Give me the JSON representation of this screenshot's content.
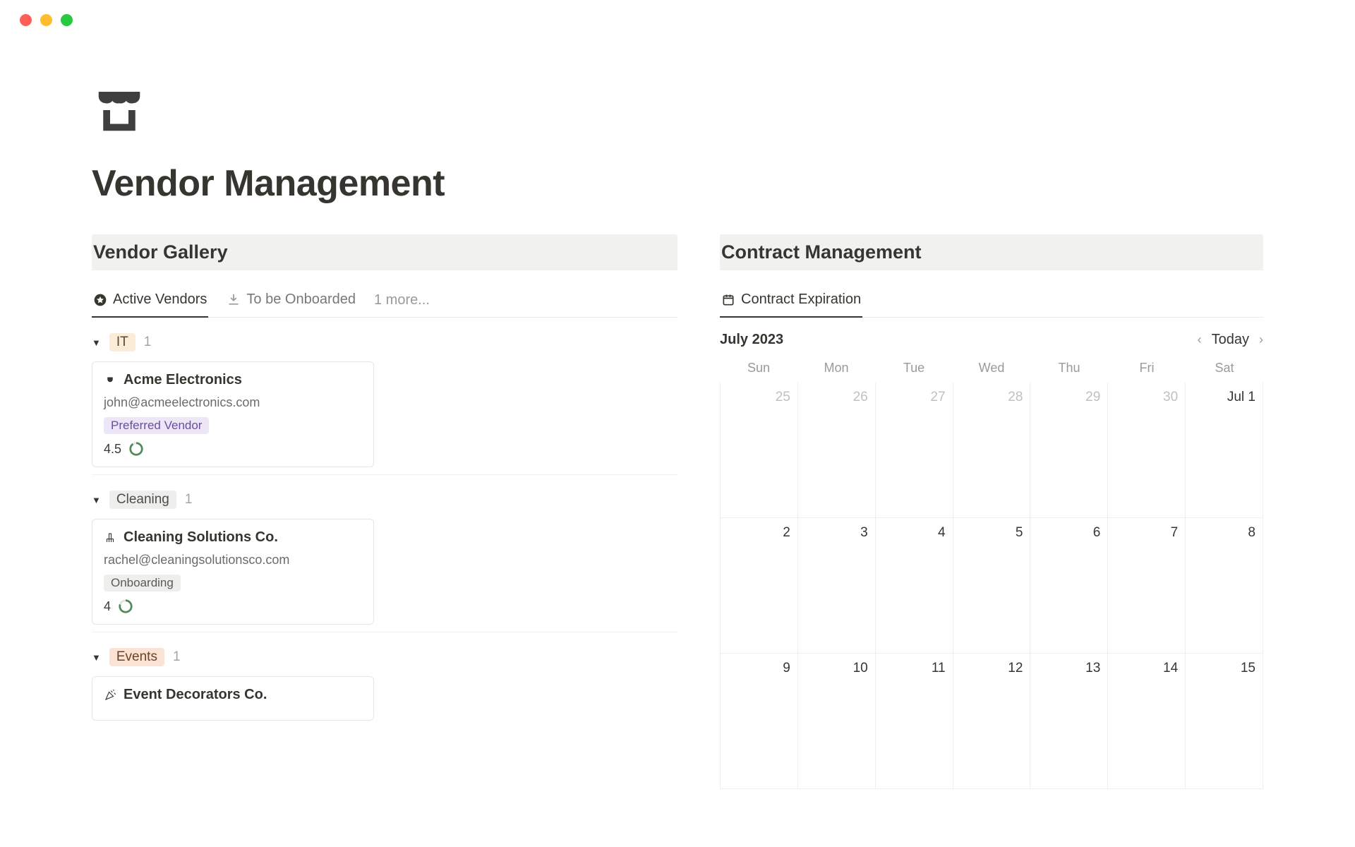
{
  "page": {
    "title": "Vendor Management"
  },
  "sections": {
    "gallery": {
      "title": "Vendor Gallery"
    },
    "contracts": {
      "title": "Contract Management"
    }
  },
  "gallery_tabs": {
    "active": "Active Vendors",
    "onboard": "To be Onboarded",
    "more": "1 more..."
  },
  "groups": {
    "it": {
      "label": "IT",
      "count": "1"
    },
    "cleaning": {
      "label": "Cleaning",
      "count": "1"
    },
    "events": {
      "label": "Events",
      "count": "1"
    }
  },
  "cards": {
    "acme": {
      "title": "Acme Electronics",
      "email": "john@acmeelectronics.com",
      "badge": "Preferred Vendor",
      "rating": "4.5"
    },
    "cleaning": {
      "title": "Cleaning Solutions Co.",
      "email": "rachel@cleaningsolutionsco.com",
      "badge": "Onboarding",
      "rating": "4"
    },
    "events": {
      "title": "Event Decorators Co."
    }
  },
  "contracts_tab": "Contract Expiration",
  "calendar": {
    "month": "July 2023",
    "today": "Today",
    "dow": {
      "sun": "Sun",
      "mon": "Mon",
      "tue": "Tue",
      "wed": "Wed",
      "thu": "Thu",
      "fri": "Fri",
      "sat": "Sat"
    },
    "row1": {
      "c0": "25",
      "c1": "26",
      "c2": "27",
      "c3": "28",
      "c4": "29",
      "c5": "30",
      "c6": "Jul 1"
    },
    "row2": {
      "c0": "2",
      "c1": "3",
      "c2": "4",
      "c3": "5",
      "c4": "6",
      "c5": "7",
      "c6": "8"
    },
    "row3": {
      "c0": "9",
      "c1": "10",
      "c2": "11",
      "c3": "12",
      "c4": "13",
      "c5": "14",
      "c6": "15"
    }
  }
}
